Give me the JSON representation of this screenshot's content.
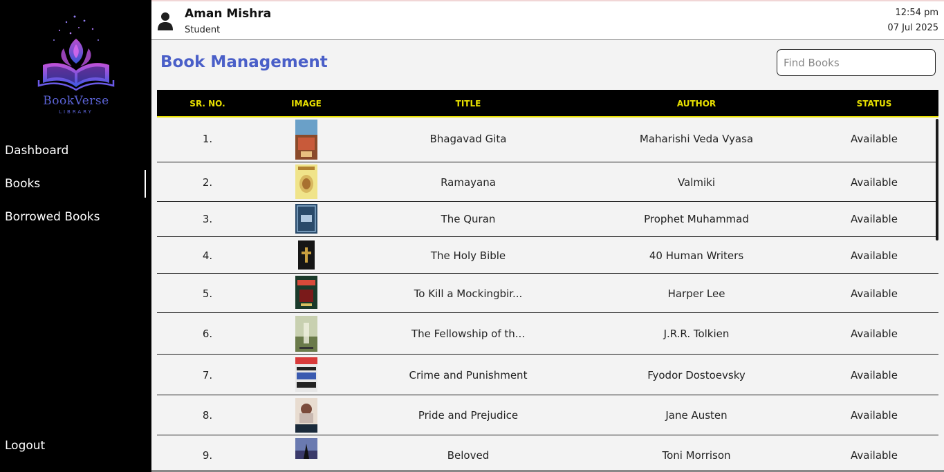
{
  "sidebar": {
    "logo": {
      "name": "BookVerse",
      "sub": "LIBRARY",
      "icon": "book-logo-icon"
    },
    "nav": [
      {
        "label": "Dashboard"
      },
      {
        "label": "Books",
        "active": true
      },
      {
        "label": "Borrowed Books"
      }
    ],
    "logout_label": "Logout"
  },
  "header": {
    "user_name": "Aman Mishra",
    "user_role": "Student",
    "time": "12:54 pm",
    "date": "07 Jul 2025"
  },
  "main": {
    "title": "Book Management",
    "search_placeholder": "Find Books",
    "columns": [
      "SR. NO.",
      "IMAGE",
      "TITLE",
      "AUTHOR",
      "STATUS"
    ],
    "rows": [
      {
        "sr": "1.",
        "title": "Bhagavad Gita",
        "author": "Maharishi Veda Vyasa",
        "status": "Available"
      },
      {
        "sr": "2.",
        "title": "Ramayana",
        "author": "Valmiki",
        "status": "Available"
      },
      {
        "sr": "3.",
        "title": "The Quran",
        "author": "Prophet Muhammad",
        "status": "Available"
      },
      {
        "sr": "4.",
        "title": "The Holy Bible",
        "author": "40 Human Writers",
        "status": "Available"
      },
      {
        "sr": "5.",
        "title": "To Kill a Mockingbir...",
        "author": "Harper Lee",
        "status": "Available"
      },
      {
        "sr": "6.",
        "title": "The Fellowship of th...",
        "author": "J.R.R. Tolkien",
        "status": "Available"
      },
      {
        "sr": "7.",
        "title": "Crime and Punishment",
        "author": "Fyodor Dostoevsky",
        "status": "Available"
      },
      {
        "sr": "8.",
        "title": "Pride and Prejudice",
        "author": "Jane Austen",
        "status": "Available"
      },
      {
        "sr": "9.",
        "title": "Beloved",
        "author": "Toni Morrison",
        "status": "Available"
      }
    ]
  },
  "colors": {
    "accent": "#4a5fc8",
    "header_text": "#e8e000",
    "sidebar_bg": "#000000"
  }
}
